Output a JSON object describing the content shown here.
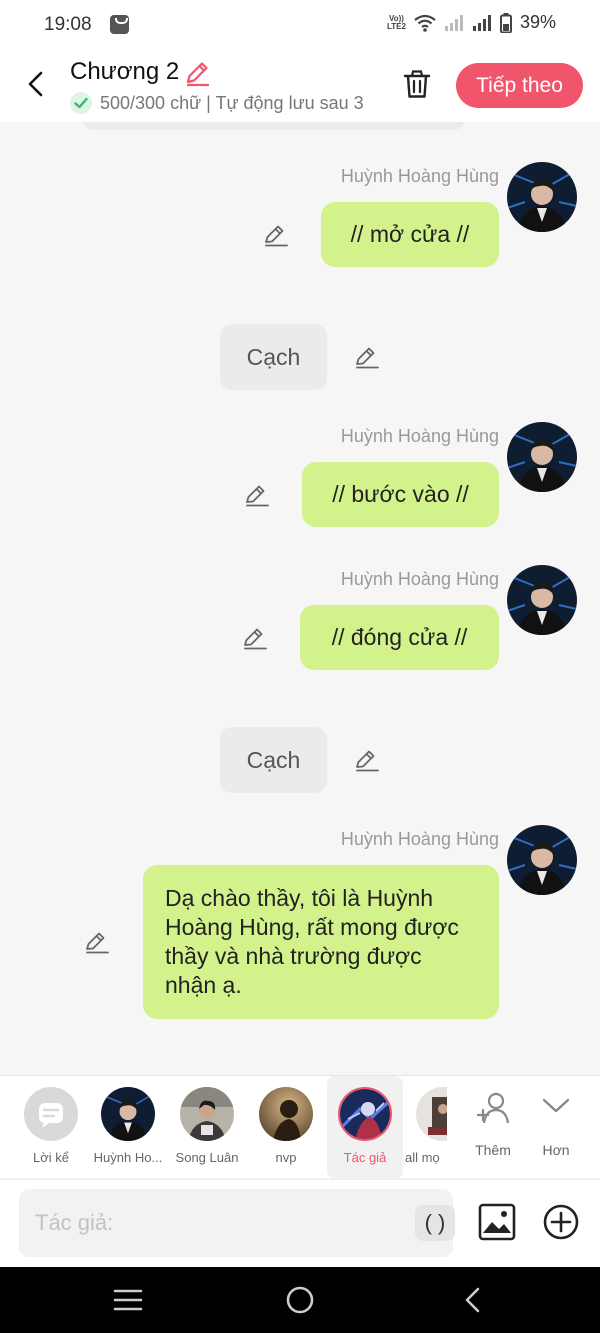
{
  "status_bar": {
    "time": "19:08",
    "network_tag_top": "Vo))",
    "network_tag_bottom": "LTE2",
    "battery_percent": "39%"
  },
  "header": {
    "chapter_title": "Chương 2",
    "word_count": "500/300 chữ | Tự động lưu sau 3",
    "next_button": "Tiếp theo"
  },
  "colors": {
    "accent": "#f0556c",
    "bubble": "#d4f28c",
    "narration_bubble": "#ebebeb"
  },
  "messages": [
    {
      "sender": "Huỳnh Hoàng Hùng",
      "text": "// mở cửa //"
    },
    {
      "type": "narration",
      "text": "Cạch"
    },
    {
      "sender": "Huỳnh Hoàng Hùng",
      "text": "// bước vào //"
    },
    {
      "sender": "Huỳnh Hoàng Hùng",
      "text": "// đóng cửa //"
    },
    {
      "type": "narration",
      "text": "Cạch"
    },
    {
      "sender": "Huỳnh Hoàng Hùng",
      "text": "Dạ chào thầy, tôi là Huỳnh Hoàng Hùng, rất mong được thầy và nhà trường được nhận ạ."
    }
  ],
  "characters": [
    {
      "label": "Lời kể",
      "icon": "message-icon"
    },
    {
      "label": "Huỳnh Ho..."
    },
    {
      "label": "Song Luân"
    },
    {
      "label": "nvp"
    },
    {
      "label": "Tác giả",
      "selected": true
    },
    {
      "label": "all mọ"
    }
  ],
  "character_actions": {
    "add_label": "Thêm",
    "more_label": "Hơn"
  },
  "input": {
    "placeholder": "Tác giả:",
    "paren_button": "( )"
  },
  "icons": [
    "back-arrow-icon",
    "pencil-icon",
    "check-icon",
    "trash-icon",
    "image-icon",
    "plus-circle-icon",
    "add-person-icon",
    "chevron-down-icon",
    "menu-icon",
    "home-circle-icon",
    "back-triangle-icon"
  ]
}
